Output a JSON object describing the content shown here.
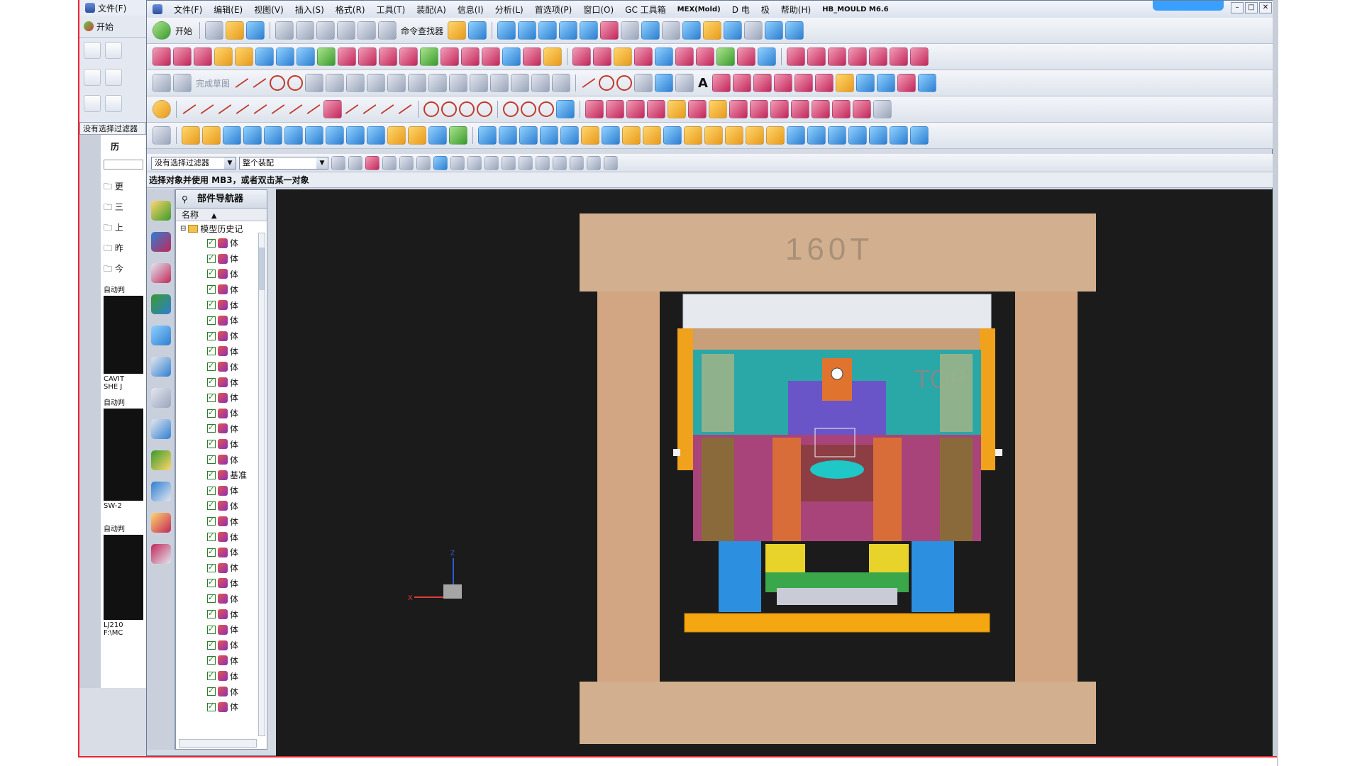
{
  "bgwin": {
    "menu_label": "文件(F)",
    "start_label": "开始",
    "filter_label": "没有选择过滤器",
    "history_label": "历",
    "tree_items": [
      "更",
      "三",
      "上",
      "昨",
      "今"
    ],
    "auto_label_1": "自动判",
    "caption_1": "CAVIT",
    "caption_2": "SHE J",
    "auto_label_2": "自动判",
    "caption_3": "SW-2",
    "auto_label_3": "自动判",
    "caption_4": "LJ210",
    "caption_5": "F:\\MC"
  },
  "menubar": {
    "items": [
      "文件(F)",
      "编辑(E)",
      "视图(V)",
      "插入(S)",
      "格式(R)",
      "工具(T)",
      "装配(A)",
      "信息(I)",
      "分析(L)",
      "首选项(P)",
      "窗口(O)",
      "GC 工具箱",
      "MEX(Mold)",
      "D 电",
      "极",
      "帮助(H)",
      "HB_MOULD M6.6"
    ]
  },
  "toolbar": {
    "start_label": "开始",
    "command_finder_label": "命令查找器",
    "finish_sketch_label": "完成草图"
  },
  "filter": {
    "selection_filter": "没有选择过滤器",
    "assembly_scope": "整个装配"
  },
  "status": {
    "prompt": "选择对象并使用 MB3，或者双击某一对象"
  },
  "navigator": {
    "title": "部件导航器",
    "column_name": "名称",
    "root": "模型历史记",
    "rows": [
      "体",
      "体",
      "体",
      "体",
      "体",
      "体",
      "体",
      "体",
      "体",
      "体",
      "体",
      "体",
      "体",
      "体",
      "体",
      "基准",
      "体",
      "体",
      "体",
      "体",
      "体",
      "体",
      "体",
      "体",
      "体",
      "体",
      "体",
      "体",
      "体",
      "体",
      "体"
    ]
  },
  "viewport": {
    "press_label": "160T",
    "view_label": "TOP",
    "axis_x": "X",
    "axis_z": "Z"
  }
}
